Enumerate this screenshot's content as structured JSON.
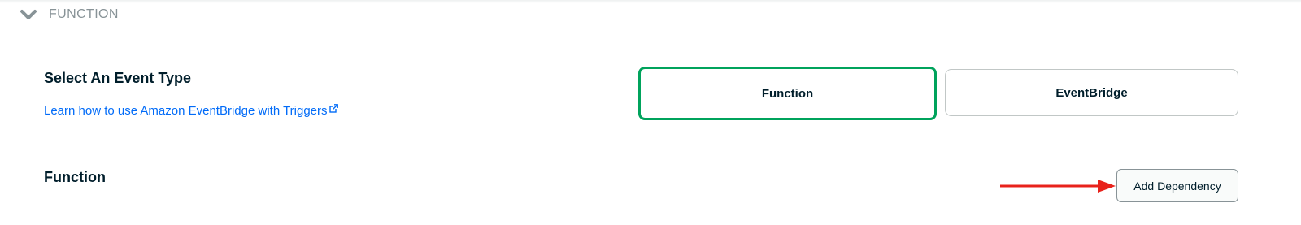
{
  "section": {
    "title": "FUNCTION",
    "chevron_icon": "chevron-down-icon"
  },
  "event_type": {
    "title": "Select An Event Type",
    "link_text": "Learn how to use Amazon EventBridge with Triggers",
    "link_icon": "external-link-icon",
    "options": [
      {
        "label": "Function",
        "selected": true
      },
      {
        "label": "EventBridge",
        "selected": false
      }
    ]
  },
  "function_section": {
    "title": "Function",
    "add_dependency_label": "Add Dependency"
  },
  "colors": {
    "selected_border": "#00a35c",
    "link": "#016bf8",
    "annotation_arrow": "#e8221b"
  }
}
